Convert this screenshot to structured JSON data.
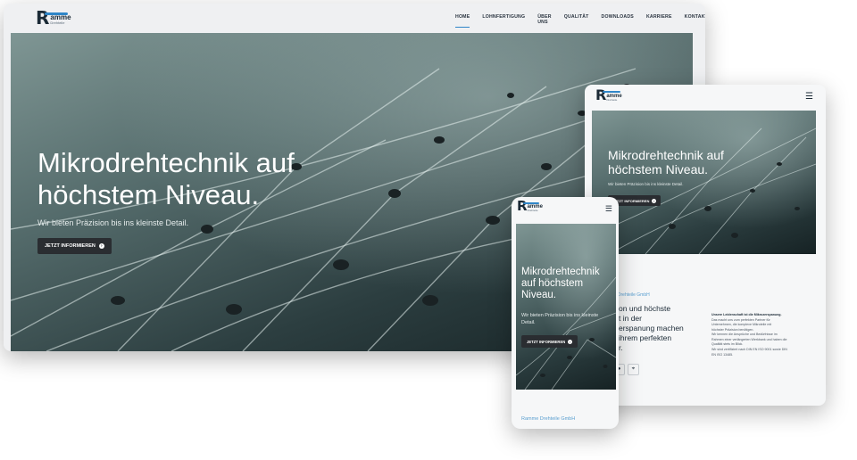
{
  "brand": {
    "letter": "R",
    "name": "amme",
    "sub": "Drehteile",
    "full": "Ramme Drehteile GmbH"
  },
  "nav": [
    "HOME",
    "LOHNFERTIGUNG",
    "ÜBER UNS",
    "QUALITÄT",
    "DOWNLOADS",
    "KARRIERE",
    "KONTAKT"
  ],
  "hero": {
    "title": "Mikrodrehtechnik auf höchstem Niveau.",
    "subtitle": "Wir bieten Präzision bis ins kleinste Detail.",
    "cta": "JETZT INFORMIEREN"
  },
  "tablet": {
    "company_label": "Ramme Drehteile GmbH",
    "headline_lines": [
      "on und höchste",
      "t in der",
      "erspanung machen",
      "ihrem perfekten",
      "r."
    ],
    "side_title": "Unsere Leidenschaft ist die Mikrozerspanung.",
    "side_lines": [
      "Das macht uns zum perfekten Partner für",
      "Unternehmen, die komplexe Mikroteile mit",
      "höchster Präzision benötigen.",
      "Wir kennen die Ansprüche und Bedürfnisse im",
      "Rahmen einer verlängerten Werkbank und haben die",
      "Qualität stets im Blick.",
      "Wir sind zertifiziert nach DIN EN ISO 9001 sowie DIN",
      "EN ISO 13485."
    ]
  },
  "mobile": {
    "footer_company": "Ramme Drehteile GmbH"
  },
  "icons": {
    "menu": "hamburger-icon",
    "cta_arrow": "arrow-right-circle-icon",
    "location": "map-pin-icon"
  },
  "colors": {
    "accent": "#2f86c8",
    "dark": "#1b2a36",
    "button": "#2a2d31"
  }
}
